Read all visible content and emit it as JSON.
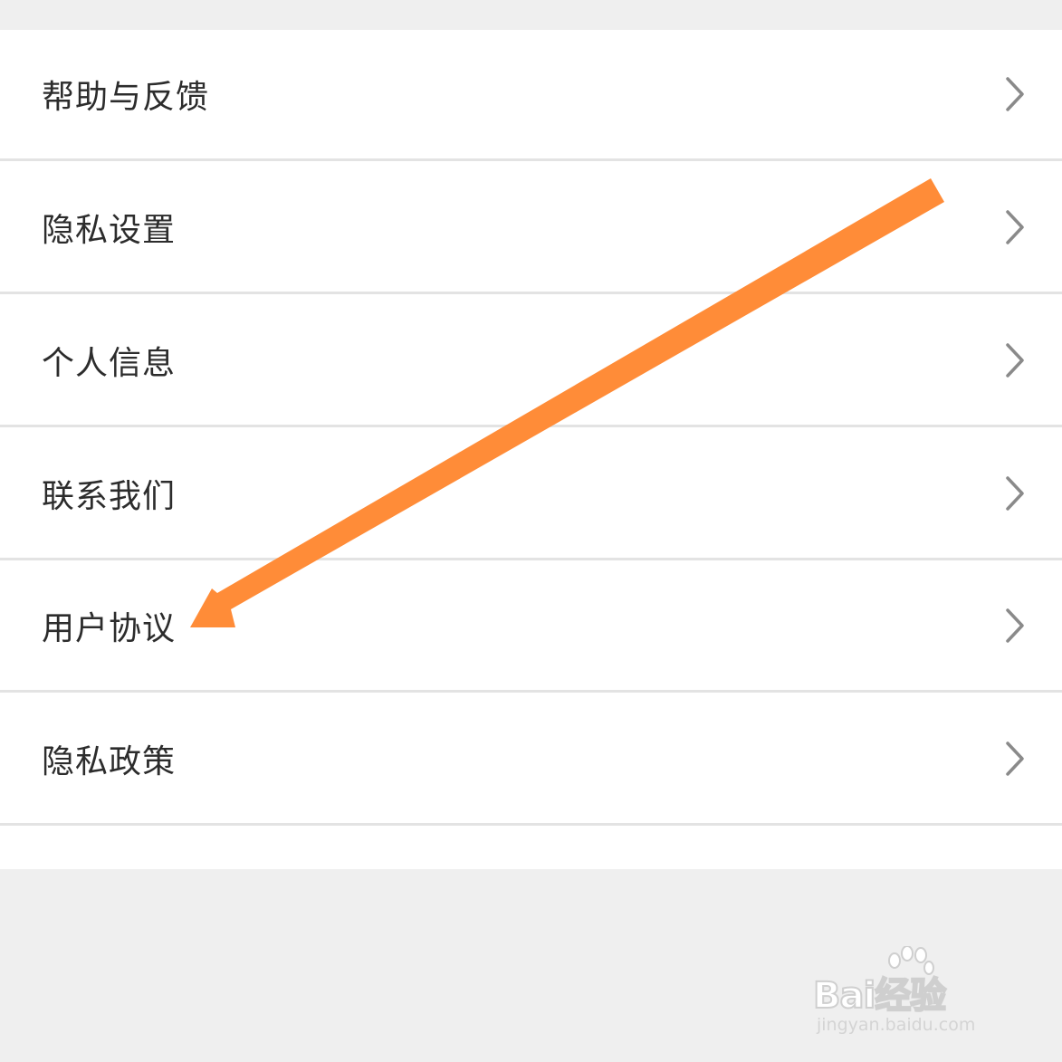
{
  "menu": {
    "items": [
      {
        "label": "帮助与反馈",
        "icon": "chevron-right-icon"
      },
      {
        "label": "隐私设置",
        "icon": "chevron-right-icon"
      },
      {
        "label": "个人信息",
        "icon": "chevron-right-icon"
      },
      {
        "label": "联系我们",
        "icon": "chevron-right-icon"
      },
      {
        "label": "用户协议",
        "icon": "chevron-right-icon"
      },
      {
        "label": "隐私政策",
        "icon": "chevron-right-icon"
      }
    ]
  },
  "annotation": {
    "arrow_color": "#ff8c38",
    "points_to": "用户协议"
  },
  "watermark": {
    "logo_text": "Bai经验",
    "url": "jingyan.baidu.com"
  },
  "colors": {
    "background": "#efefef",
    "list_background": "#ffffff",
    "divider": "#e3e3e3",
    "text": "#2c2c2c",
    "chevron": "#8a8a8a"
  }
}
